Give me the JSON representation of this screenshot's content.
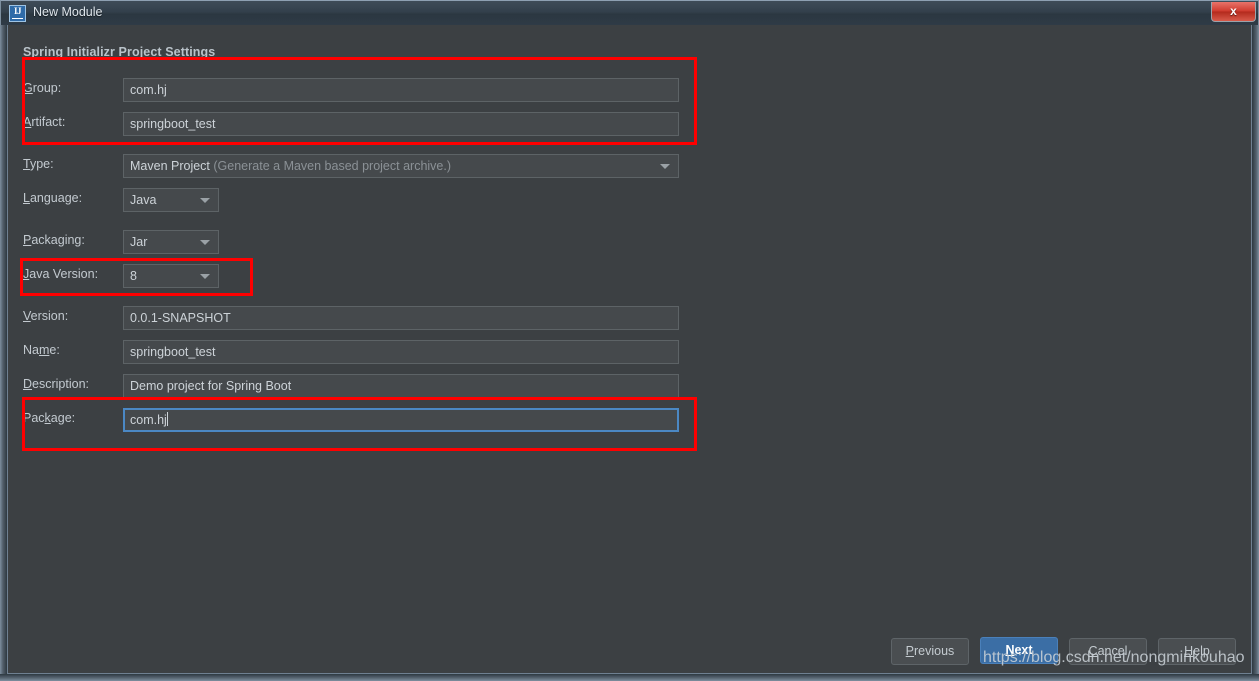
{
  "window": {
    "title": "New Module",
    "app_icon": "intellij-idea-icon",
    "close_label": "x"
  },
  "form": {
    "section_title": "Spring Initializr Project Settings",
    "fields": [
      {
        "label_pre": "",
        "label_mnemonic": "G",
        "label_post": "roup:",
        "value": "com.hj",
        "type": "text"
      },
      {
        "label_pre": "",
        "label_mnemonic": "A",
        "label_post": "rtifact:",
        "value": "springboot_test",
        "type": "text"
      },
      {
        "label_pre": "",
        "label_mnemonic": "T",
        "label_post": "ype:",
        "value": "Maven Project",
        "hint": "(Generate a Maven based project archive.)",
        "type": "combo-wide"
      },
      {
        "label_pre": "",
        "label_mnemonic": "L",
        "label_post": "anguage:",
        "value": "Java",
        "type": "combo-small"
      },
      {
        "label_pre": "",
        "label_mnemonic": "P",
        "label_post": "ackaging:",
        "value": "Jar",
        "type": "combo-small"
      },
      {
        "label_pre": "",
        "label_mnemonic": "J",
        "label_post": "ava Version:",
        "value": "8",
        "type": "combo-small"
      },
      {
        "label_pre": "",
        "label_mnemonic": "V",
        "label_post": "ersion:",
        "value": "0.0.1-SNAPSHOT",
        "type": "text"
      },
      {
        "label_pre": "Na",
        "label_mnemonic": "m",
        "label_post": "e:",
        "value": "springboot_test",
        "type": "text"
      },
      {
        "label_pre": "",
        "label_mnemonic": "D",
        "label_post": "escription:",
        "value": "Demo project for Spring Boot",
        "type": "text"
      },
      {
        "label_pre": "Pac",
        "label_mnemonic": "k",
        "label_post": "age:",
        "value": "com.hj",
        "type": "text-focused"
      }
    ]
  },
  "buttons": {
    "previous": {
      "pre": "",
      "mnemonic": "P",
      "post": "revious"
    },
    "next": {
      "pre": "",
      "mnemonic": "N",
      "post": "ext"
    },
    "cancel": {
      "pre": "",
      "mnemonic": "C",
      "post": "ancel"
    },
    "help": {
      "pre": "",
      "mnemonic": "H",
      "post": "elp"
    }
  },
  "annotations": {
    "colors": {
      "highlight": "#ff0000",
      "accent": "#3b6ea5",
      "focus_border": "#4b88c4"
    },
    "boxes": [
      {
        "name": "group-artifact-highlight"
      },
      {
        "name": "java-version-highlight"
      },
      {
        "name": "package-highlight"
      }
    ]
  },
  "watermark": {
    "text": "https://blog.csdn.net/nongminkouhao"
  }
}
